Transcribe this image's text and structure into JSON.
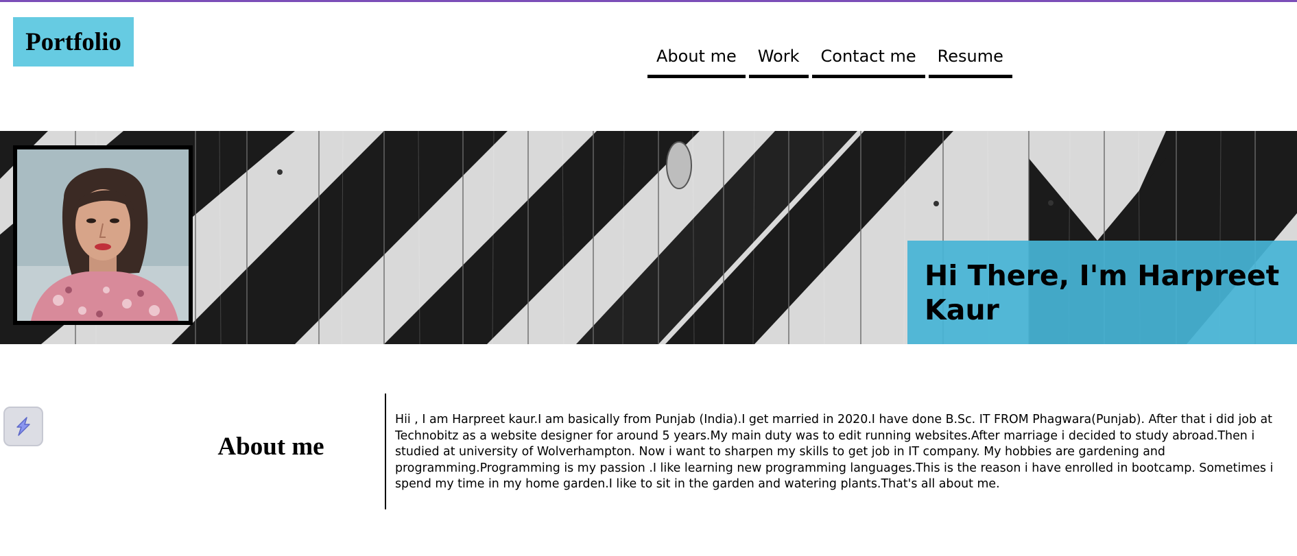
{
  "brand": {
    "logo_text": "Portfolio",
    "logo_bg": "#66cbe2",
    "accent_top": "#7b4fb8"
  },
  "nav": {
    "items": [
      {
        "label": "About me"
      },
      {
        "label": "Work"
      },
      {
        "label": "Contact me"
      },
      {
        "label": "Resume"
      }
    ]
  },
  "hero": {
    "background_image": "black-and-white-striped-wood-banner",
    "profile_photo": "profile-photo-portrait",
    "title": "Hi There, I'm Harpreet Kaur",
    "title_box_color": "#46b4d6"
  },
  "about": {
    "heading": "About me",
    "body": "Hii , I am Harpreet kaur.I am basically from Punjab (India).I get married in 2020.I have done B.Sc. IT FROM Phagwara(Punjab). After that i did job at Technobitz as a website designer for around 5 years.My main duty was to edit running websites.After marriage i decided to study abroad.Then i studied at university of Wolverhampton. Now i want to sharpen my skills to get job in IT company. My hobbies are gardening and programming.Programming is my passion .I like learning new programming languages.This is the reason i have enrolled in bootcamp. Sometimes i spend my time in my home garden.I like to sit in the garden and watering plants.That's all about me."
  },
  "widget": {
    "icon": "extension-icon"
  }
}
